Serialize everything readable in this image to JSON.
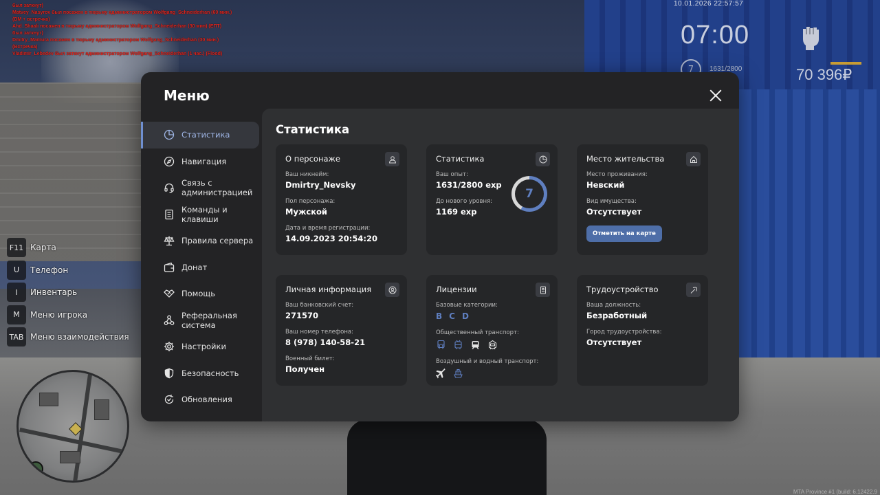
{
  "chat": {
    "lines": [
      "был заткнут)",
      "Matvey_Nasyrov был посажен в тюрьму администратором Wolfgang_Schneiderhan (60 мин.) (DM + встречка)",
      "Ahd_Shaali посажен в тюрьму администратором Wolfgang_Schneiderhan (30 мин) (ЕПТ)",
      "был заткнут)",
      "Dmitry_Mamura посажен в тюрьму администратором Wolfgang_Schneiderhan (30 мин.) (Встречка)",
      "Vladimir_Lebedev был заткнут администратором Wolfgang_Schneiderhan (1 час.) (Flood)"
    ]
  },
  "hud": {
    "date": "10.01.2026 22:57:57",
    "time": "07:00",
    "level": "7",
    "exp": "1631/2800",
    "money": "70 396₽"
  },
  "hotkeys": [
    {
      "key": "F11",
      "label": "Карта"
    },
    {
      "key": "U",
      "label": "Телефон"
    },
    {
      "key": "I",
      "label": "Инвентарь"
    },
    {
      "key": "M",
      "label": "Меню игрока"
    },
    {
      "key": "TAB",
      "label": "Меню взаимодействия"
    }
  ],
  "build": "MTA Province #1 (build: 6.12422.9",
  "menu": {
    "title": "Меню",
    "nav": [
      {
        "label": "Статистика",
        "icon": "pie-chart-icon",
        "active": true
      },
      {
        "label": "Навигация",
        "icon": "compass-icon"
      },
      {
        "label": "Связь с администрацией",
        "icon": "headset-icon"
      },
      {
        "label": "Команды и клавиши",
        "icon": "document-icon"
      },
      {
        "label": "Правила сервера",
        "icon": "scales-icon"
      },
      {
        "label": "Донат",
        "icon": "wallet-icon"
      },
      {
        "label": "Помощь",
        "icon": "handshake-icon"
      },
      {
        "label": "Реферальная система",
        "icon": "network-icon"
      },
      {
        "label": "Настройки",
        "icon": "gear-icon"
      },
      {
        "label": "Безопасность",
        "icon": "shield-icon"
      },
      {
        "label": "Обновления",
        "icon": "refresh-icon"
      }
    ],
    "content_title": "Статистика",
    "cards": {
      "character": {
        "title": "О персонаже",
        "nickname_label": "Ваш никнейм:",
        "nickname": "Dmirtry_Nevsky",
        "gender_label": "Пол персонажа:",
        "gender": "Мужской",
        "reg_label": "Дата и время регистрации:",
        "reg": "14.09.2023 20:54:20"
      },
      "stats": {
        "title": "Статистика",
        "exp_label": "Ваш опыт:",
        "exp": "1631/2800 exp",
        "next_label": "До нового уровня:",
        "next": "1169 exp",
        "level": "7",
        "progress": 0.58
      },
      "residence": {
        "title": "Место жительства",
        "place_label": "Место проживания:",
        "place": "Невский",
        "property_label": "Вид имущества:",
        "property": "Отсутствует",
        "button": "Отметить на карте"
      },
      "personal": {
        "title": "Личная информация",
        "bank_label": "Ваш банковский счет:",
        "bank": "271570",
        "phone_label": "Ваш номер телефона:",
        "phone": "8 (978) 140-58-21",
        "military_label": "Военный билет:",
        "military": "Получен"
      },
      "licenses": {
        "title": "Лицензии",
        "base_label": "Базовые категории:",
        "categories": [
          "B",
          "C",
          "D"
        ],
        "public_label": "Общественный транспорт:",
        "air_label": "Воздушный и водный транспорт:"
      },
      "employment": {
        "title": "Трудоустройство",
        "position_label": "Ваша должность:",
        "position": "Безработный",
        "city_label": "Город трудоустройства:",
        "city": "Отсутствует"
      }
    }
  },
  "colors": {
    "accent": "#5f7fc0",
    "panel": "#232325",
    "card": "#252628"
  }
}
